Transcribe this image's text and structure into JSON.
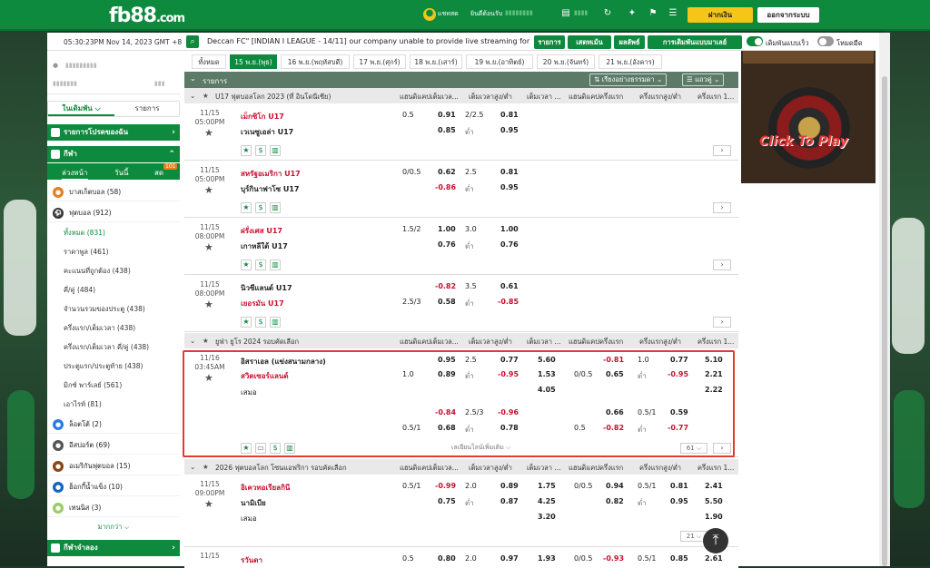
{
  "brand": {
    "name": "fb88",
    "domain": ".com"
  },
  "topnav": {
    "livechat": "แชทสด",
    "welcome": "ยินดีต้อนรับ",
    "deposit": "ฝากเงิน",
    "logout": "ออกจากระบบ"
  },
  "infobar": {
    "clock": "05:30:23PM Nov 14, 2023 GMT +8",
    "ticker": "Deccan FC\" [INDIAN I LEAGUE - 14/11] our company unable to provide live streaming for",
    "btn_list": "รายการ",
    "btn_live": "เสตทเม้น",
    "btn_results": "ผลลัพธ์",
    "btn_settings": "การเดิมพันแบบมาเลย์",
    "fast_bet": "เดิมพันแบบเร็ว",
    "dark_mode": "โหมดมืด"
  },
  "sidebar": {
    "tabs": [
      "ในเดิมพัน",
      "รายการ"
    ],
    "favorites": "รายการโปรดของฉัน",
    "sports_header": "กีฬา",
    "sport_tabs": [
      "ล่วงหน้า",
      "วันนี้",
      "สด"
    ],
    "live_badge": "101",
    "items": [
      {
        "label": "บาสเก็ตบอล (58)",
        "icon": "basketball-icon",
        "color": "#e67e22"
      },
      {
        "label": "ฟุตบอล (912)",
        "icon": "soccer-icon",
        "color": "#333333"
      }
    ],
    "soccer_subs": [
      "ทั้งหมด (831)",
      "ราคาพูล (461)",
      "คะแนนที่ถูกต้อง (438)",
      "คี่/คู่ (484)",
      "จำนวนรวมของประตู (438)",
      "ครึ่งแรก/เต็มเวลา (438)",
      "ครึ่งแรก/เต็มเวลา คี่/คู่ (438)",
      "ประตูแรก/ประตูท้าย (438)",
      "มิกซ์ พาร์เลย์ (561)",
      "เอาไรท์ (81)"
    ],
    "other_items": [
      {
        "label": "ล็อตโต้ (2)",
        "icon": "lotto-icon",
        "color": "#2c7be5"
      },
      {
        "label": "อีสปอร์ต (69)",
        "icon": "esports-icon",
        "color": "#555555"
      },
      {
        "label": "อเมริกันฟุตบอล (15)",
        "icon": "american-football-icon",
        "color": "#8b4513"
      },
      {
        "label": "ฮ็อกกี้น้ำแข็ง (10)",
        "icon": "ice-hockey-icon",
        "color": "#1565c0"
      },
      {
        "label": "เทนนิส (3)",
        "icon": "tennis-icon",
        "color": "#9ccc65"
      }
    ],
    "more": "มากกว่า",
    "virtual": "กีฬาจำลอง"
  },
  "datetabs": [
    "ทั้งหมด",
    "15 พ.ย.(พุธ)",
    "16 พ.ย.(พฤหัสบดี)",
    "17 พ.ย.(ศุกร์)",
    "18 พ.ย.(เสาร์)",
    "19 พ.ย.(อาทิตย์)",
    "20 พ.ย.(จันทร์)",
    "21 พ.ย.(อังคาร)"
  ],
  "listhdr": {
    "title": "รายการ",
    "sort": "เรียงอย่างธรรมดา",
    "rows": "แถวคู่"
  },
  "colheads": {
    "c1": "แฮนดิแคปเต็มเวล...",
    "c2": "เต็มเวลาสูง/ต่ำ",
    "c3": "เต็มเวลา ...",
    "c4": "แฮนดิแคปครึ่งแรก",
    "c5": "ครึ่งแรกสูง/ต่ำ",
    "c6": "ครึ่งแรก 1..."
  },
  "leagues": [
    {
      "title": "U17 ฟุตบอลโลก 2023 (ที่ อินโดนีเซีย)",
      "matches": [
        {
          "date": "11/15",
          "time": "05:00PM",
          "home": "เม็กซิโก U17",
          "away": "เวเนซูเอล่า U17",
          "hc": "0.5",
          "h1": "0.91",
          "h2": "0.85",
          "ou": "2/2.5",
          "ou_low": "ต่ำ",
          "o1": "0.81",
          "o2": "0.95"
        },
        {
          "date": "11/15",
          "time": "05:00PM",
          "home": "สหรัฐอเมริกา U17",
          "away": "บุร์กินาฟาโซ U17",
          "hc": "0/0.5",
          "h1": "0.62",
          "h2": "-0.86",
          "ou": "2.5",
          "ou_low": "ต่ำ",
          "o1": "0.81",
          "o2": "0.95"
        },
        {
          "date": "11/15",
          "time": "08:00PM",
          "home": "ฝรั่งเศส U17",
          "away": "เกาหลีใต้ U17",
          "hc": "1.5/2",
          "h1": "1.00",
          "h2": "0.76",
          "ou": "3.0",
          "ou_low": "ต่ำ",
          "o1": "1.00",
          "o2": "0.76"
        },
        {
          "date": "11/15",
          "time": "08:00PM",
          "home": "นิวซีแลนด์ U17",
          "away": "เยอรมัน U17",
          "hc": "2.5/3",
          "h1": "-0.82",
          "h2": "0.58",
          "ou": "3.5",
          "ou_low": "ต่ำ",
          "o1": "0.61",
          "o2": "-0.85"
        }
      ]
    },
    {
      "title": "ยูฟ่า ยูโร 2024 รอบคัดเลือก",
      "match": {
        "date": "11/16",
        "time": "03:45AM",
        "home": "อิสราเอล (แข่งสนามกลาง)",
        "away": "สวิตเซอร์แลนด์",
        "draw": "เสมอ",
        "r1": {
          "hc": "",
          "h1": "0.95",
          "ou": "2.5",
          "o1": "0.77",
          "x1": "5.60",
          "fhc": "",
          "fh1": "-0.81",
          "fou": "1.0",
          "fo1": "0.77",
          "f1": "5.10"
        },
        "r2": {
          "hc": "1.0",
          "h1": "0.89",
          "ou": "ต่ำ",
          "o1": "-0.95",
          "x1": "1.53",
          "fhc": "0/0.5",
          "fh1": "0.65",
          "fou": "ต่ำ",
          "fo1": "-0.95",
          "f1": "2.21"
        },
        "r3": {
          "x1": "4.05",
          "f1": "2.22"
        },
        "r4": {
          "h1": "-0.84",
          "ou": "2.5/3",
          "o1": "-0.96",
          "fh1": "0.66",
          "fou": "0.5/1",
          "fo1": "0.59"
        },
        "r5": {
          "hc": "0.5/1",
          "h1": "0.68",
          "ou": "ต่ำ",
          "o1": "0.78",
          "fhc": "0.5",
          "fh1": "-0.82",
          "fou": "ต่ำ",
          "fo1": "-0.77"
        },
        "more_lines": "เลเยียนไลน์เพิ่มเติม",
        "count": "61"
      }
    },
    {
      "title": "2026 ฟุตบอลโลก โซนแอฟริกา รอบคัดเลือก",
      "match": {
        "date": "11/15",
        "time": "09:00PM",
        "home": "อิเควทอเรียลกินี",
        "away": "นามิเบีย",
        "draw": "เสมอ",
        "r1": {
          "hc": "0.5/1",
          "h1": "-0.99",
          "ou": "2.0",
          "o1": "0.89",
          "x1": "1.75",
          "fhc": "0/0.5",
          "fh1": "0.94",
          "fou": "0.5/1",
          "fo1": "0.81",
          "f1": "2.41"
        },
        "r2": {
          "h1": "0.75",
          "ou": "ต่ำ",
          "o1": "0.87",
          "x1": "4.25",
          "fh1": "0.82",
          "fou": "ต่ำ",
          "fo1": "0.95",
          "f1": "5.50"
        },
        "r3": {
          "x1": "3.20",
          "f1": "1.90"
        },
        "count": "21"
      }
    },
    {
      "title": "",
      "match": {
        "date": "11/15",
        "home": "รวันดา",
        "hc": "0.5",
        "h1": "0.80",
        "ou": "2.0",
        "o1": "0.97",
        "x1": "1.93",
        "fhc": "0/0.5",
        "fh1": "-0.93",
        "fou": "0.5/1",
        "fo1": "0.85",
        "f1": "2.61"
      }
    }
  ],
  "banner": {
    "text": "Click To Play"
  },
  "colors": {
    "brand_green": "#0e8a3e",
    "odds_red": "#c8102e",
    "highlight": "#e53935",
    "deposit_yellow": "#f5c518"
  }
}
